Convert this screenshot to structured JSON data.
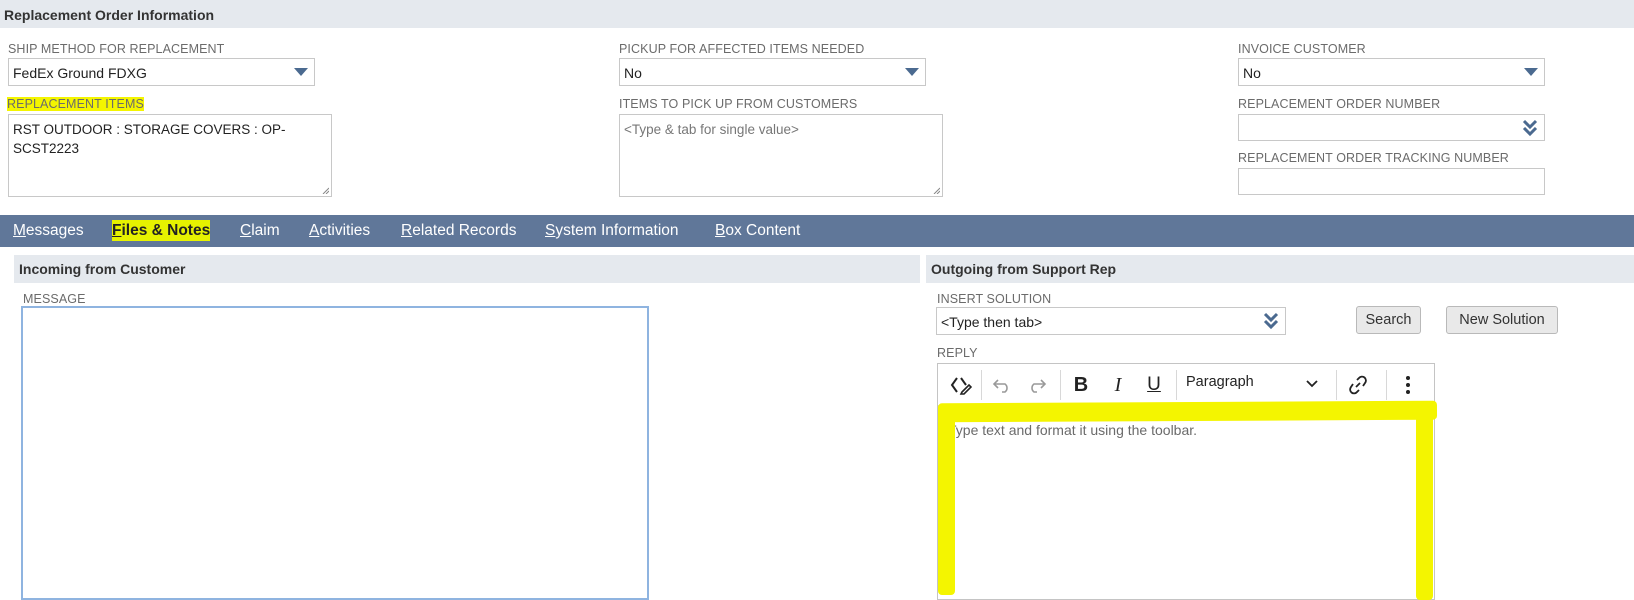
{
  "section_title": "Replacement Order Information",
  "fields": {
    "ship_method": {
      "label": "SHIP METHOD FOR REPLACEMENT",
      "value": "FedEx Ground FDXG"
    },
    "pickup_needed": {
      "label": "PICKUP FOR AFFECTED ITEMS NEEDED",
      "value": "No"
    },
    "invoice_customer": {
      "label": "INVOICE CUSTOMER",
      "value": "No"
    },
    "replacement_items": {
      "label": "REPLACEMENT ITEMS",
      "value": "RST OUTDOOR : STORAGE COVERS : OP-SCST2223"
    },
    "items_to_pickup": {
      "label": "ITEMS TO PICK UP FROM CUSTOMERS",
      "placeholder": "<Type & tab for single value>"
    },
    "replacement_order_number": {
      "label": "REPLACEMENT ORDER NUMBER",
      "value": ""
    },
    "replacement_order_tracking": {
      "label": "REPLACEMENT ORDER TRACKING NUMBER",
      "value": ""
    }
  },
  "tabs": [
    {
      "first": "M",
      "rest": "essages",
      "active": false
    },
    {
      "first": "F",
      "rest": "iles & Notes",
      "active": true
    },
    {
      "first": "C",
      "rest": "laim",
      "active": false
    },
    {
      "first": "A",
      "rest": "ctivities",
      "active": false
    },
    {
      "first": "R",
      "rest": "elated Records",
      "active": false
    },
    {
      "first": "S",
      "rest": "ystem Information",
      "active": false
    },
    {
      "first": "B",
      "rest": "ox Content",
      "active": false
    }
  ],
  "incoming": {
    "title": "Incoming from Customer",
    "message_label": "MESSAGE",
    "message_value": ""
  },
  "outgoing": {
    "title": "Outgoing from Support Rep",
    "insert_solution_label": "INSERT SOLUTION",
    "insert_solution_placeholder": "<Type then tab>",
    "search_button": "Search",
    "new_solution_button": "New Solution",
    "reply_label": "REPLY",
    "paragraph_format": "Paragraph",
    "editor_placeholder": "Type text and format it using the toolbar."
  },
  "colors": {
    "tab_bar": "#607799",
    "section_bg": "#e5e9ee",
    "highlight": "#f4f500",
    "caret": "#4b6a90"
  },
  "icons": [
    "caret-down-icon",
    "double-chevron-down-icon",
    "source-code-icon",
    "undo-icon",
    "redo-icon",
    "bold-icon",
    "italic-icon",
    "underline-icon",
    "link-icon",
    "more-vertical-icon",
    "resize-grip-icon"
  ]
}
